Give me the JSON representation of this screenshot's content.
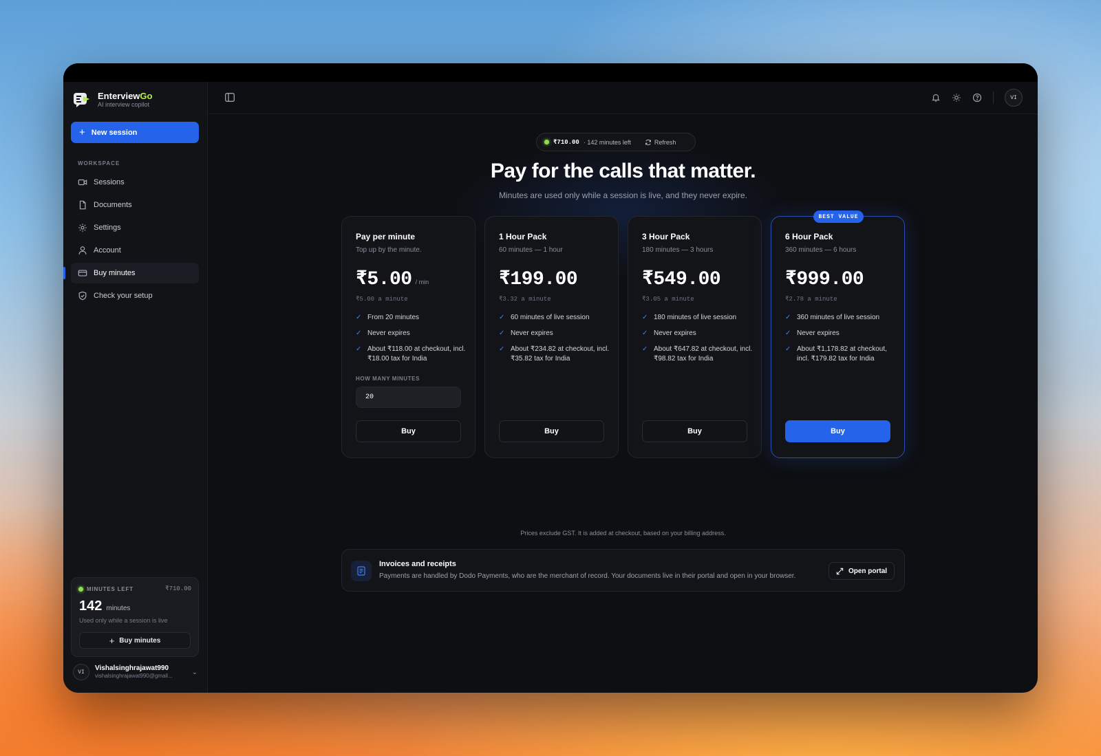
{
  "brand": {
    "name_main": "Enterview",
    "name_accent": "Go",
    "tagline": "AI interview copilot",
    "accent_color": "#b6f23a"
  },
  "sidebar": {
    "new_session_label": "New session",
    "section_label": "WORKSPACE",
    "items": [
      {
        "label": "Sessions",
        "icon": "video-icon"
      },
      {
        "label": "Documents",
        "icon": "document-icon"
      },
      {
        "label": "Settings",
        "icon": "gear-icon"
      },
      {
        "label": "Account",
        "icon": "user-icon"
      },
      {
        "label": "Buy minutes",
        "icon": "card-icon",
        "active": true
      },
      {
        "label": "Check your setup",
        "icon": "shield-check-icon"
      }
    ],
    "minutes_card": {
      "label": "MINUTES LEFT",
      "balance": "₹710.00",
      "count": "142",
      "unit": "minutes",
      "note": "Used only while a session is live",
      "buy_label": "Buy minutes"
    },
    "user": {
      "initials": "VI",
      "name": "Vishalsinghrajawat990",
      "email": "vishalsinghrajawat990@gmail..."
    }
  },
  "topbar": {
    "avatar_initials": "VI"
  },
  "main": {
    "balance_pill": {
      "amount": "₹710.00",
      "minutes": "· 142 minutes left",
      "refresh_label": "Refresh"
    },
    "headline": "Pay for the calls that matter.",
    "subhead": "Minutes are used only while a session is live, and they never expire.",
    "plans": [
      {
        "title": "Pay per minute",
        "subtitle": "Top up by the minute.",
        "price": "₹5.00",
        "per": "/ min",
        "rate": "₹5.00 a minute",
        "features": [
          "From 20 minutes",
          "Never expires",
          "About ₹118.00 at checkout, incl. ₹18.00 tax for India"
        ],
        "qty_label": "HOW MANY MINUTES",
        "qty_value": "20",
        "buy_label": "Buy"
      },
      {
        "title": "1 Hour Pack",
        "subtitle": "60 minutes — 1 hour",
        "price": "₹199.00",
        "rate": "₹3.32 a minute",
        "features": [
          "60 minutes of live session",
          "Never expires",
          "About ₹234.82 at checkout, incl. ₹35.82 tax for India"
        ],
        "buy_label": "Buy"
      },
      {
        "title": "3 Hour Pack",
        "subtitle": "180 minutes — 3 hours",
        "price": "₹549.00",
        "rate": "₹3.05 a minute",
        "features": [
          "180 minutes of live session",
          "Never expires",
          "About ₹647.82 at checkout, incl. ₹98.82 tax for India"
        ],
        "buy_label": "Buy"
      },
      {
        "title": "6 Hour Pack",
        "subtitle": "360 minutes — 6 hours",
        "price": "₹999.00",
        "rate": "₹2.78 a minute",
        "badge": "BEST VALUE",
        "features": [
          "360 minutes of live session",
          "Never expires",
          "About ₹1,178.82 at checkout, incl. ₹179.82 tax for India"
        ],
        "buy_label": "Buy"
      }
    ],
    "gst_note": "Prices exclude GST. It is added at checkout, based on your billing address.",
    "invoices": {
      "title": "Invoices and receipts",
      "description": "Payments are handled by Dodo Payments, who are the merchant of record. Your documents live in their portal and open in your browser.",
      "button_label": "Open portal"
    }
  },
  "colors": {
    "primary": "#2563eb",
    "status_green": "#8ee04a",
    "background": "#0e0f12"
  }
}
